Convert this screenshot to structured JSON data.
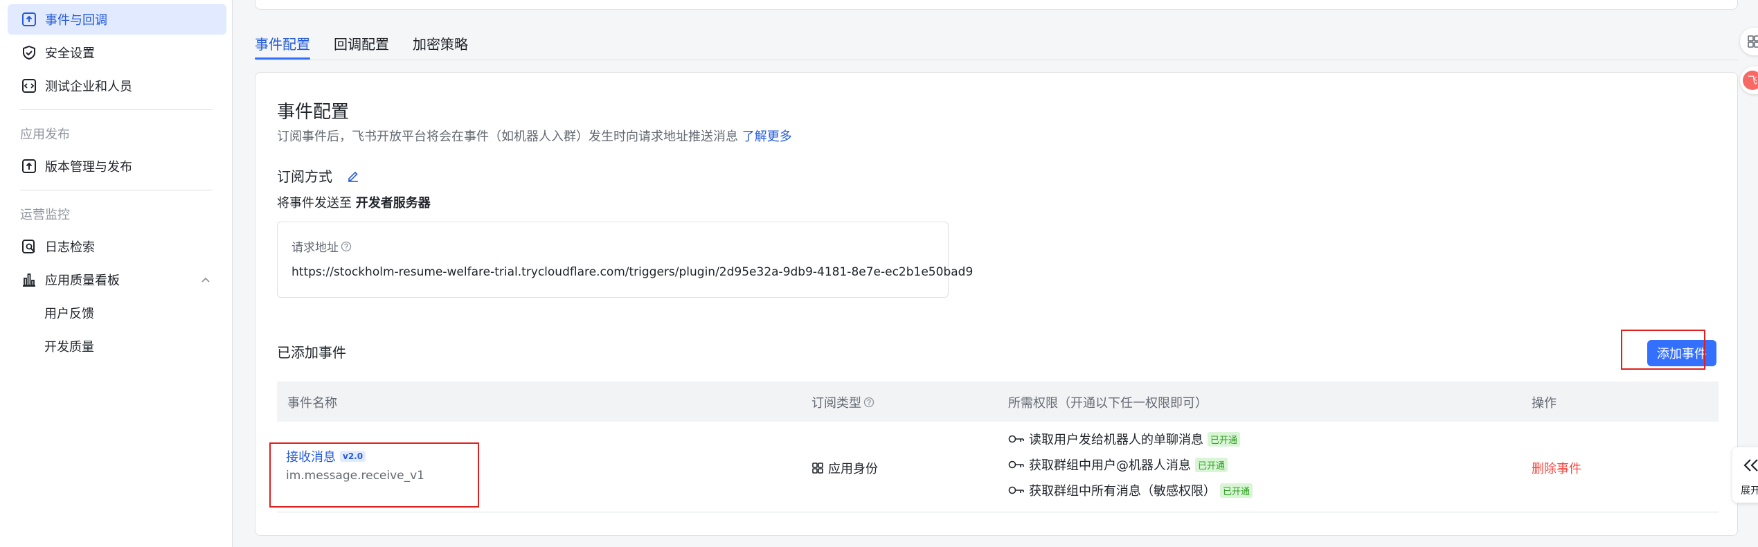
{
  "sidebar": {
    "items": [
      {
        "label": "事件与回调",
        "icon": "event-callback-icon",
        "active": true
      },
      {
        "label": "安全设置",
        "icon": "shield-icon"
      },
      {
        "label": "测试企业和人员",
        "icon": "code-icon"
      }
    ],
    "group_publish": "应用发布",
    "publish_items": [
      {
        "label": "版本管理与发布",
        "icon": "upload-icon"
      }
    ],
    "group_monitor": "运营监控",
    "monitor_items": [
      {
        "label": "日志检索",
        "icon": "log-search-icon"
      },
      {
        "label": "应用质量看板",
        "icon": "bar-chart-icon"
      }
    ],
    "sub_items": [
      "用户反馈",
      "开发质量"
    ]
  },
  "tabs": [
    {
      "label": "事件配置",
      "active": true
    },
    {
      "label": "回调配置"
    },
    {
      "label": "加密策略"
    }
  ],
  "main": {
    "title": "事件配置",
    "description": "订阅事件后，飞书开放平台将会在事件（如机器人入群）发生时向请求地址推送消息",
    "learn_more": "了解更多",
    "subscribe_label": "订阅方式",
    "send_to_prefix": "将事件发送至",
    "send_to_target": "开发者服务器",
    "url_label": "请求地址",
    "url_value": "https://stockholm-resume-welfare-trial.trycloudflare.com/triggers/plugin/2d95e32a-9db9-4181-8e7e-ec2b1e50bad9",
    "added_events": "已添加事件",
    "add_event_button": "添加事件"
  },
  "table": {
    "headers": {
      "name": "事件名称",
      "type": "订阅类型",
      "perm": "所需权限（开通以下任一权限即可）",
      "action": "操作"
    },
    "rows": [
      {
        "name": "接收消息",
        "version": "v2.0",
        "code": "im.message.receive_v1",
        "type": "应用身份",
        "permissions": [
          {
            "label": "读取用户发给机器人的单聊消息",
            "status": "已开通"
          },
          {
            "label": "获取群组中用户@机器人消息",
            "status": "已开通"
          },
          {
            "label": "获取群组中所有消息（敏感权限）",
            "status": "已开通"
          }
        ],
        "action": "删除事件"
      }
    ]
  },
  "side_float": {
    "avatar_text": "飞",
    "expand_label": "展开"
  },
  "colors": {
    "accent": "#3370ff",
    "link": "#245bdb",
    "danger": "#f54a45",
    "success": "#2ea121",
    "highlight": "#e0201c"
  }
}
